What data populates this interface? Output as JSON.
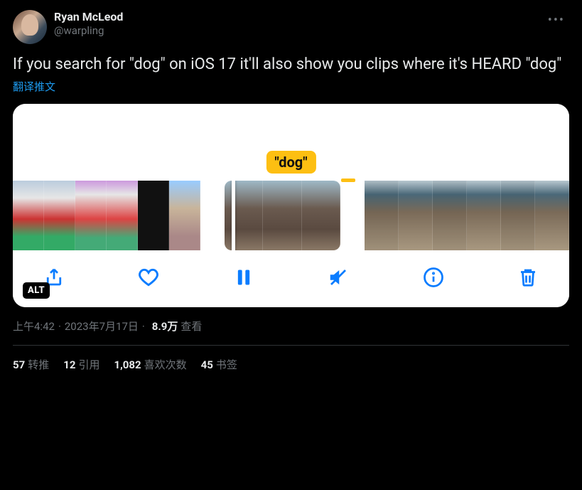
{
  "author": {
    "display_name": "Ryan McLeod",
    "handle": "@warpling"
  },
  "tweet_text": "If you search for \"dog\" on iOS 17 it'll also show you clips where it's HEARD \"dog\"",
  "translate_label": "翻译推文",
  "media": {
    "dog_label": "\"dog\"",
    "alt_badge": "ALT",
    "controls": {
      "share": "share",
      "like": "like",
      "pause": "pause",
      "mute": "mute",
      "info": "info",
      "trash": "trash"
    }
  },
  "meta": {
    "time": "上午4:42",
    "date": "2023年7月17日",
    "views_number": "8.9万",
    "views_label": "查看"
  },
  "stats": {
    "retweets_num": "57",
    "retweets_label": "转推",
    "quotes_num": "12",
    "quotes_label": "引用",
    "likes_num": "1,082",
    "likes_label": "喜欢次数",
    "bookmarks_num": "45",
    "bookmarks_label": "书签"
  }
}
